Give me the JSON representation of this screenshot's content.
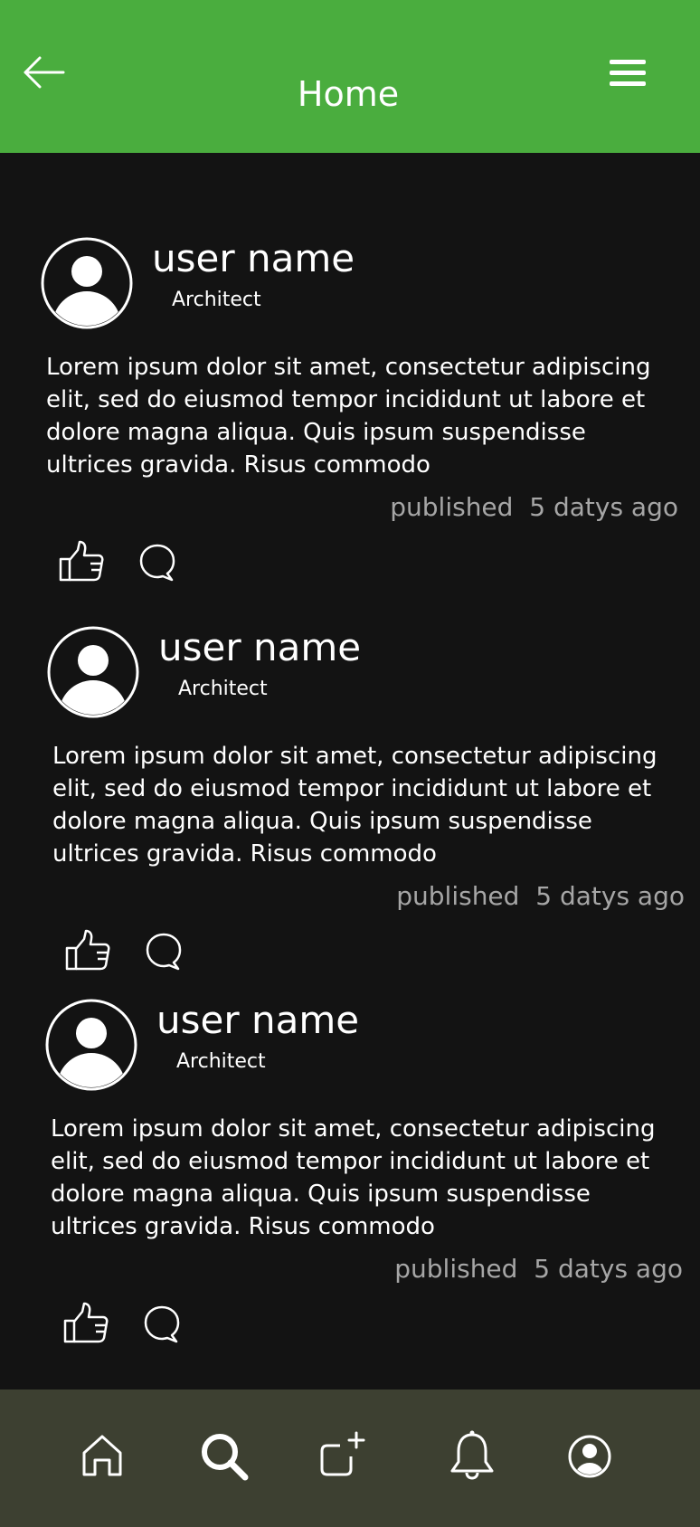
{
  "header": {
    "title": "Home",
    "bg_color": "#4aad3e",
    "back_icon": "arrow-left-icon",
    "menu_icon": "hamburger-menu-icon"
  },
  "posts": [
    {
      "user_name": "user name",
      "role": "Architect",
      "body": "Lorem ipsum dolor sit amet, consectetur adipiscing elit, sed do eiusmod tempor incididunt ut labore et dolore magna aliqua. Quis ipsum suspendisse ultrices gravida. Risus commodo",
      "published_label": "published",
      "published_time": "5 datys ago"
    },
    {
      "user_name": "user name",
      "role": "Architect",
      "body": "Lorem ipsum dolor sit amet, consectetur adipiscing elit, sed do eiusmod tempor incididunt ut labore et dolore magna aliqua. Quis ipsum suspendisse ultrices gravida. Risus commodo",
      "published_label": "published",
      "published_time": "5 datys ago"
    },
    {
      "user_name": "user name",
      "role": "Architect",
      "body": "Lorem ipsum dolor sit amet, consectetur adipiscing elit, sed do eiusmod tempor incididunt ut labore et dolore magna aliqua. Quis ipsum suspendisse ultrices gravida. Risus commodo",
      "published_label": "published",
      "published_time": "5 datys ago"
    }
  ],
  "bottom_nav": {
    "bg_color": "#3d4031",
    "items": [
      "home-icon",
      "search-icon",
      "add-post-icon",
      "bell-icon",
      "profile-icon"
    ]
  }
}
